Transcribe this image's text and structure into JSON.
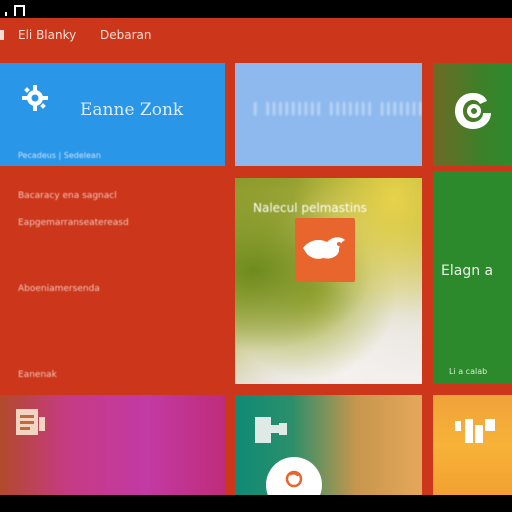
{
  "nav": {
    "items": [
      {
        "label": "Eli Blanky"
      },
      {
        "label": "Debaran"
      }
    ]
  },
  "tiles": {
    "blue": {
      "title": "Eanne Zonk",
      "caption": "Pecadeus | Sedelean",
      "color": "#2a96e8"
    },
    "lightblue": {
      "title": "| ||||||||| ||||||| ||||||| |",
      "color": "#8db9ee"
    },
    "darkgreen": {
      "icon": "swirl-logo-icon"
    },
    "center": {
      "title": "Nalecul pelmastins",
      "badge_icon": "bird-icon"
    },
    "green": {
      "title": "Elagn a",
      "caption": "Li a calab",
      "color": "#2d8a2c"
    },
    "magenta": {
      "icon": "document-icon"
    },
    "teal": {
      "icon": "puzzle-icon",
      "button_icon": "search-icon"
    },
    "orange": {
      "icon": "app-icon"
    }
  },
  "panel": {
    "lines": [
      "Bacaracy ena sagnacl",
      "Eapgemarranseatereasd",
      "Aboeniamersenda",
      "Eanenak"
    ]
  },
  "colors": {
    "app_background": "#cc361b",
    "accent_orange": "#e8652d"
  }
}
